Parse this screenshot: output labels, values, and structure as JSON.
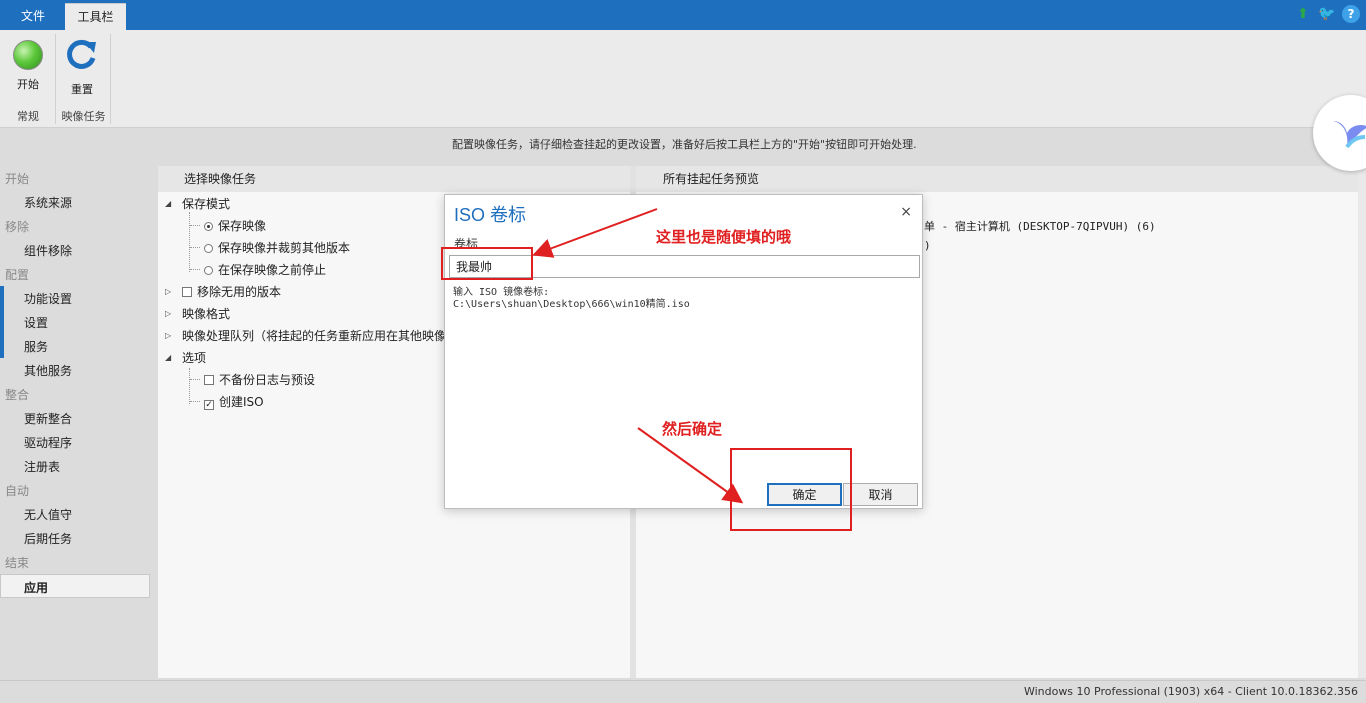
{
  "tabs": {
    "file": "文件",
    "toolbar": "工具栏"
  },
  "ribbon": {
    "start_label": "开始",
    "reset_label": "重置",
    "group_general": "常规",
    "group_image_task": "映像任务"
  },
  "info_text": "配置映像任务，请仔细检查挂起的更改设置，准备好后按工具栏上方的\"开始\"按钮即可开始处理.",
  "nav": {
    "sections": [
      {
        "heading": "开始",
        "items": [
          "系统来源"
        ]
      },
      {
        "heading": "移除",
        "items": [
          "组件移除"
        ]
      },
      {
        "heading": "配置",
        "items": [
          "功能设置",
          "设置",
          "服务",
          "其他服务"
        ]
      },
      {
        "heading": "整合",
        "items": [
          "更新整合",
          "驱动程序",
          "注册表"
        ]
      },
      {
        "heading": "自动",
        "items": [
          "无人值守",
          "后期任务"
        ]
      },
      {
        "heading": "结束",
        "items": [
          "应用"
        ]
      }
    ]
  },
  "left_pane": {
    "title": "选择映像任务",
    "tree": {
      "save_mode": "保存模式",
      "save_image": "保存映像",
      "save_and_trim": "保存映像并裁剪其他版本",
      "stop_before_save": "在保存映像之前停止",
      "remove_unused": "移除无用的版本",
      "image_format": "映像格式",
      "image_queue": "映像处理队列（将挂起的任务重新应用在其他映像",
      "options": "选项",
      "no_backup": "不备份日志与预设",
      "create_iso": "创建ISO"
    }
  },
  "right_pane": {
    "title": "所有挂起任务预览",
    "line1": "单 - 宿主计算机 (DESKTOP-7QIPVUH) (6)",
    "line2": ")"
  },
  "status_text": "Windows 10 Professional (1903) x64 - Client 10.0.18362.356",
  "dialog": {
    "title": "ISO 卷标",
    "close": "×",
    "field_label": "卷标",
    "field_value": "我最帅",
    "hint_line1": "输入 ISO 镜像卷标:",
    "hint_line2": "C:\\Users\\shuan\\Desktop\\666\\win10精简.iso",
    "ok_label": "确定",
    "cancel_label": "取消"
  },
  "annotations": {
    "note1": "这里也是随便填的哦",
    "note2": "然后确定"
  },
  "icons": [
    "up-arrow-icon",
    "twitter-bird-icon",
    "help-icon",
    "start-orb-icon",
    "reset-refresh-icon",
    "close-icon"
  ],
  "colors": {
    "title_bar": "#1f6fbf",
    "annotation_red": "#e02020",
    "dialog_title": "#1f6fbf"
  }
}
